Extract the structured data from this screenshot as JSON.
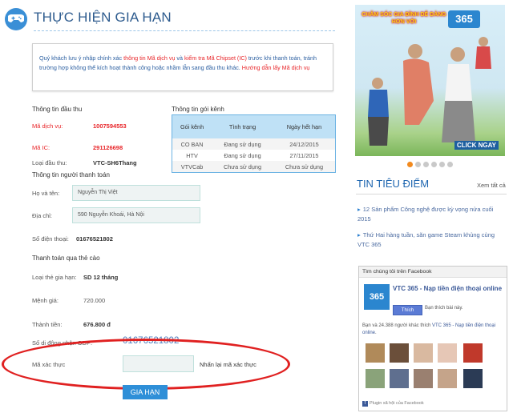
{
  "page": {
    "title": "THỰC HIỆN GIA HẠN",
    "notice": {
      "part1": "Quý khách lưu ý nhập chính xác ",
      "part2": "thông tin Mã dịch vụ",
      "part3": " và ",
      "part4": "kiểm tra Mã Chipset (IC)",
      "part5": " trước khi thanh toán, tránh trường hợp không thể kích hoạt thành công hoặc nhầm lẫn sang đầu thu khác. ",
      "part6": "Hướng dẫn lấy Mã dịch vụ"
    }
  },
  "receiver": {
    "section_title": "Thông tin đầu thu",
    "service_code_label": "Mã dịch vụ:",
    "service_code": "1007594553",
    "ic_label": "Mã IC:",
    "ic": "291126698",
    "type_label": "Loại đầu thu:",
    "type": "VTC-SH6Thang"
  },
  "package": {
    "section_title": "Thông tin gói kênh",
    "headers": [
      "Gói kênh",
      "Tình trạng",
      "Ngày hết hạn"
    ],
    "rows": [
      [
        "CO BAN",
        "Đang sử dụng",
        "24/12/2015"
      ],
      [
        "HTV",
        "Đang sử dụng",
        "27/11/2015"
      ],
      [
        "VTVCab",
        "Chưa sử dụng",
        "Chưa sử dụng"
      ]
    ]
  },
  "payer": {
    "section_title": "Thông tin người thanh toán",
    "name_label": "Họ và tên:",
    "name": "Nguyễn Thị Việt",
    "address_label": "Địa chỉ:",
    "address": "590 Nguyễn Khoái, Hà Nội",
    "phone_label": "Số điện thoại:",
    "phone": "01676521802"
  },
  "payment": {
    "section_title": "Thanh toán qua thẻ cào",
    "period_label": "Loại thẻ gia hạn:",
    "period": "SD 12 tháng",
    "denomination_label": "Mệnh giá:",
    "denomination": "720.000",
    "amount_label": "Thành tiền:",
    "amount": "676.800 đ",
    "odp_label": "Số di động nhận ODP:",
    "odp": "01676521802",
    "captcha_label": "Mã xác thực",
    "captcha_value": "",
    "captcha_refresh": "Nhấn lại mã xác thực",
    "submit": "GIA HẠN"
  },
  "banner": {
    "slogan": "CHĂM SÓC GIA ĐÌNH DỄ DÀNG HƠN VỚI",
    "logo": "365",
    "cta": "CLICK NGAY",
    "slides": 6,
    "active_slide": 1
  },
  "news": {
    "title": "TIN TIÊU ĐIỂM",
    "more": "Xem tất cả",
    "items": [
      "12 Sản phẩm Công nghệ được kỳ vọng nửa cuối 2015",
      "Thứ Hai hàng tuần, săn game Steam khủng cùng VTC 365"
    ]
  },
  "facebook": {
    "header": "Tìm chúng tôi trên Facebook",
    "logo": "365",
    "page_name": "VTC 365 - Nạp tiền điện thoại online",
    "like_button": "Thích",
    "like_text": "Bạn thích bài này.",
    "people_text_1": "Bạn và 24.388 người khác thích ",
    "people_link": "VTC 365 - Nạp tiền điện thoại online",
    "people_text_2": ".",
    "plugin_text": "Plugin xã hội của Facebook"
  },
  "colors": {
    "accent": "#2e8fd8",
    "title": "#2d5b8e",
    "red": "#e8262a",
    "table_header": "#bfe1f6",
    "annotation": "#e02020"
  }
}
